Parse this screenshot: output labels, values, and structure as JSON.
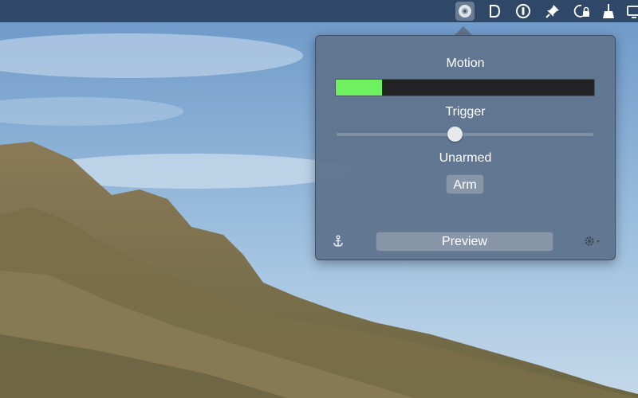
{
  "menubar": {
    "icons": [
      "app-eye-icon",
      "d-letter-icon",
      "power-circle-icon",
      "pin-icon",
      "clock-lock-icon",
      "broom-icon",
      "display-icon"
    ]
  },
  "popover": {
    "motion_label": "Motion",
    "motion_level": 0.18,
    "motion_color": "#6ef05f",
    "trigger_label": "Trigger",
    "trigger_value": 0.46,
    "status_label": "Unarmed",
    "arm_label": "Arm",
    "preview_label": "Preview",
    "left_icon": "anchor-icon",
    "right_icon": "gear-icon"
  }
}
